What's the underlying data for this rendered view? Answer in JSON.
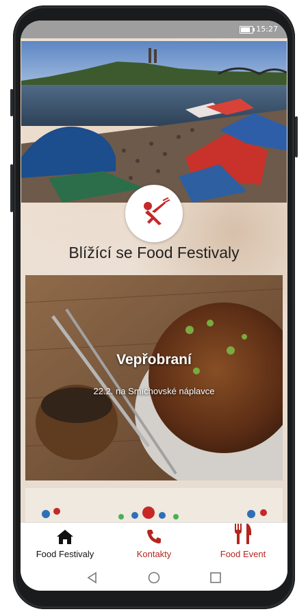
{
  "status": {
    "time": "15:27"
  },
  "main": {
    "section_title": "Blížící se Food Festivaly",
    "events": [
      {
        "title": "Vepřobraní",
        "subtitle": "22.2. na Smíchovské náplavce"
      }
    ]
  },
  "tabs": [
    {
      "label": "Food Festivaly",
      "icon": "home-icon",
      "active": true
    },
    {
      "label": "Kontakty",
      "icon": "phone-icon",
      "active": false
    },
    {
      "label": "Food Event",
      "icon": "fork-knife-icon",
      "active": false
    }
  ],
  "colors": {
    "accent": "#b3261e",
    "active_text": "#111111"
  }
}
